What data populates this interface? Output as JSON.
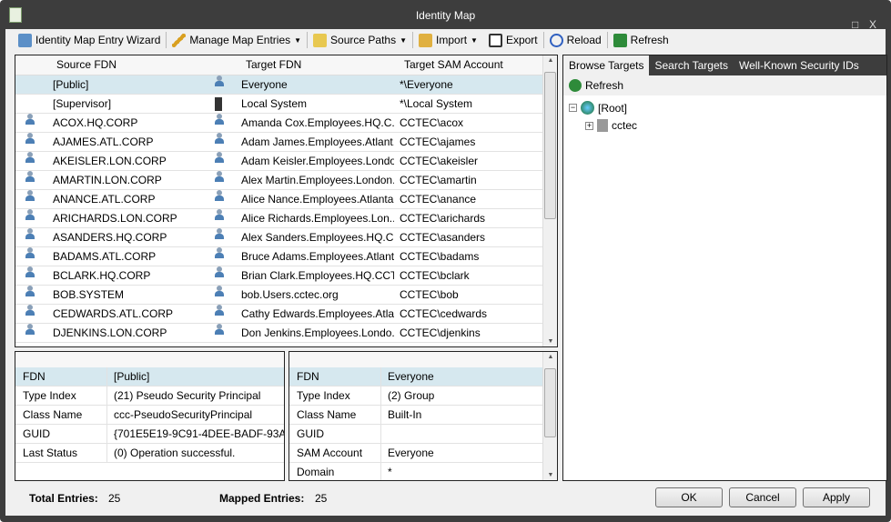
{
  "window": {
    "title": "Identity Map",
    "minimize": "_",
    "maximize": "□",
    "close": "X"
  },
  "toolbar": {
    "wizard": "Identity Map Entry Wizard",
    "manage": "Manage Map Entries",
    "source_paths": "Source Paths",
    "import": "Import",
    "export": "Export",
    "reload": "Reload",
    "refresh": "Refresh"
  },
  "grid": {
    "headers": [
      "Source FDN",
      "Target FDN",
      "Target SAM Account"
    ],
    "rows": [
      {
        "source": "[Public]",
        "target": "Everyone",
        "sam": "*\\Everyone"
      },
      {
        "source": "[Supervisor]",
        "target": "Local System",
        "sam": "*\\Local System"
      },
      {
        "source": "ACOX.HQ.CORP",
        "target": "Amanda Cox.Employees.HQ.C...",
        "sam": "CCTEC\\acox"
      },
      {
        "source": "AJAMES.ATL.CORP",
        "target": "Adam James.Employees.Atlant...",
        "sam": "CCTEC\\ajames"
      },
      {
        "source": "AKEISLER.LON.CORP",
        "target": "Adam Keisler.Employees.Londo...",
        "sam": "CCTEC\\akeisler"
      },
      {
        "source": "AMARTIN.LON.CORP",
        "target": "Alex Martin.Employees.London....",
        "sam": "CCTEC\\amartin"
      },
      {
        "source": "ANANCE.ATL.CORP",
        "target": "Alice Nance.Employees.Atlanta...",
        "sam": "CCTEC\\anance"
      },
      {
        "source": "ARICHARDS.LON.CORP",
        "target": "Alice Richards.Employees.Lon...",
        "sam": "CCTEC\\arichards"
      },
      {
        "source": "ASANDERS.HQ.CORP",
        "target": "Alex Sanders.Employees.HQ.C...",
        "sam": "CCTEC\\asanders"
      },
      {
        "source": "BADAMS.ATL.CORP",
        "target": "Bruce Adams.Employees.Atlant...",
        "sam": "CCTEC\\badams"
      },
      {
        "source": "BCLARK.HQ.CORP",
        "target": "Brian Clark.Employees.HQ.CCT...",
        "sam": "CCTEC\\bclark"
      },
      {
        "source": "BOB.SYSTEM",
        "target": "bob.Users.cctec.org",
        "sam": "CCTEC\\bob"
      },
      {
        "source": "CEDWARDS.ATL.CORP",
        "target": "Cathy Edwards.Employees.Atla...",
        "sam": "CCTEC\\cedwards"
      },
      {
        "source": "DJENKINS.LON.CORP",
        "target": "Don Jenkins.Employees.Londo...",
        "sam": "CCTEC\\djenkins"
      }
    ]
  },
  "right": {
    "tabs": [
      "Browse Targets",
      "Search Targets",
      "Well-Known Security IDs"
    ],
    "refresh": "Refresh",
    "tree": {
      "root": "[Root]",
      "child": "cctec"
    }
  },
  "source_details": [
    [
      "FDN",
      "[Public]"
    ],
    [
      "Type Index",
      "(21) Pseudo Security Principal"
    ],
    [
      "Class Name",
      "ccc-PseudoSecurityPrincipal"
    ],
    [
      "GUID",
      "{701E5E19-9C91-4DEE-BADF-93A..."
    ],
    [
      "Last Status",
      "(0) Operation successful."
    ]
  ],
  "target_details": [
    [
      "FDN",
      "Everyone"
    ],
    [
      "Type Index",
      "(2) Group"
    ],
    [
      "Class Name",
      "Built-In"
    ],
    [
      "GUID",
      ""
    ],
    [
      "SAM Account",
      "Everyone"
    ],
    [
      "Domain",
      "*"
    ]
  ],
  "footer": {
    "total_label": "Total Entries:",
    "total": "25",
    "mapped_label": "Mapped Entries:",
    "mapped": "25",
    "ok": "OK",
    "cancel": "Cancel",
    "apply": "Apply"
  }
}
